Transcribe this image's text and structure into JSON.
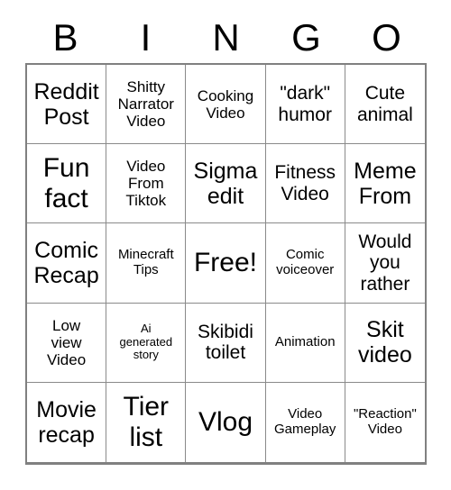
{
  "card": {
    "title": "BINGO",
    "header_letters": [
      "B",
      "I",
      "N",
      "G",
      "O"
    ],
    "free_space_label": "Free!",
    "colors": {
      "background": "#ffffff",
      "text": "#000000",
      "grid_line": "#8a8a8a",
      "outer_border": "#808080"
    },
    "grid_size": "5x5",
    "cells": [
      {
        "text": "Reddit\nPost",
        "size": "fs-lg",
        "row": 1,
        "col": 1
      },
      {
        "text": "Shitty\nNarrator\nVideo",
        "size": "fs-sm",
        "row": 1,
        "col": 2
      },
      {
        "text": "Cooking\nVideo",
        "size": "fs-sm",
        "row": 1,
        "col": 3
      },
      {
        "text": "\"dark\"\nhumor",
        "size": "fs-md",
        "row": 1,
        "col": 4
      },
      {
        "text": "Cute\nanimal",
        "size": "fs-md",
        "row": 1,
        "col": 5
      },
      {
        "text": "Fun\nfact",
        "size": "fs-xl",
        "row": 2,
        "col": 1
      },
      {
        "text": "Video\nFrom\nTiktok",
        "size": "fs-sm",
        "row": 2,
        "col": 2
      },
      {
        "text": "Sigma\nedit",
        "size": "fs-lg",
        "row": 2,
        "col": 3
      },
      {
        "text": "Fitness\nVideo",
        "size": "fs-md",
        "row": 2,
        "col": 4
      },
      {
        "text": "Meme\nFrom",
        "size": "fs-lg",
        "row": 2,
        "col": 5
      },
      {
        "text": "Comic\nRecap",
        "size": "fs-lg",
        "row": 3,
        "col": 1
      },
      {
        "text": "Minecraft\nTips",
        "size": "fs-xs",
        "row": 3,
        "col": 2
      },
      {
        "text": "Free!",
        "size": "fs-xl",
        "row": 3,
        "col": 3
      },
      {
        "text": "Comic\nvoiceover",
        "size": "fs-xs",
        "row": 3,
        "col": 4
      },
      {
        "text": "Would\nyou\nrather",
        "size": "fs-md",
        "row": 3,
        "col": 5
      },
      {
        "text": "Low\nview\nVideo",
        "size": "fs-sm",
        "row": 4,
        "col": 1
      },
      {
        "text": "Ai\ngenerated\nstory",
        "size": "fs-xxs",
        "row": 4,
        "col": 2
      },
      {
        "text": "Skibidi\ntoilet",
        "size": "fs-md",
        "row": 4,
        "col": 3
      },
      {
        "text": "Animation",
        "size": "fs-xs",
        "row": 4,
        "col": 4
      },
      {
        "text": "Skit\nvideo",
        "size": "fs-lg",
        "row": 4,
        "col": 5
      },
      {
        "text": "Movie\nrecap",
        "size": "fs-lg",
        "row": 5,
        "col": 1
      },
      {
        "text": "Tier\nlist",
        "size": "fs-xl",
        "row": 5,
        "col": 2
      },
      {
        "text": "Vlog",
        "size": "fs-xl",
        "row": 5,
        "col": 3
      },
      {
        "text": "Video\nGameplay",
        "size": "fs-xs",
        "row": 5,
        "col": 4
      },
      {
        "text": "\"Reaction\"\nVideo",
        "size": "fs-xs",
        "row": 5,
        "col": 5
      }
    ]
  }
}
